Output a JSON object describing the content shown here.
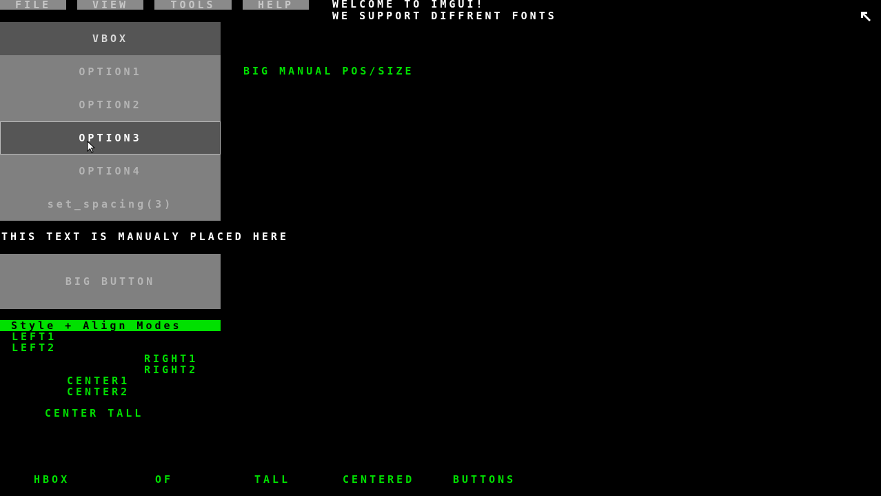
{
  "menu": {
    "items": [
      {
        "label": "FILE"
      },
      {
        "label": "VIEW"
      },
      {
        "label": "TOOLS"
      },
      {
        "label": "HELP"
      }
    ]
  },
  "header": {
    "line1": "WELCOME TO IMGUI!",
    "line2": "WE SUPPORT DIFFRENT FONTS"
  },
  "vbox": {
    "title": "VBOX",
    "options": [
      "OPTION1",
      "OPTION2",
      "OPTION3",
      "OPTION4",
      "set_spacing(3)"
    ],
    "selected_index": 2
  },
  "big_manual_label": "BIG MANUAL POS/SIZE",
  "manual_text": "THIS TEXT IS MANUALY PLACED HERE",
  "big_button_label": "BIG BUTTON",
  "style_section": {
    "title": "Style + Align Modes",
    "left1": "LEFT1",
    "left2": "LEFT2",
    "right1": "RIGHT1",
    "right2": "RIGHT2",
    "center1": "CENTER1",
    "center2": "CENTER2",
    "center_tall": "CENTER TALL"
  },
  "hbox": [
    "HBOX",
    "OF",
    "TALL",
    "CENTERED",
    "BUTTONS"
  ],
  "colors": {
    "background": "#000000",
    "accent_green": "#00e000",
    "button_gray": "#808080",
    "header_dark_gray": "#555555",
    "text_white": "#ffffff"
  }
}
